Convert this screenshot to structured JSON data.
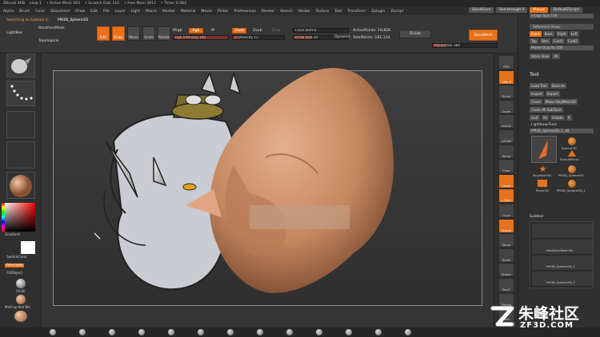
{
  "titlebar": {
    "app": "ZBrush 4R8",
    "view": "view 1",
    "active_mesh": "• Active Mesh 493",
    "scratch": "• Scratch Disk 110",
    "free_mem": "• Free Mem 3912",
    "timer": "• Timer 0.083"
  },
  "menubar": {
    "items": [
      "Alpha",
      "Brush",
      "Color",
      "Document",
      "Draw",
      "Edit",
      "File",
      "Layer",
      "Light",
      "Macro",
      "Marker",
      "Material",
      "Movie",
      "Picker",
      "Preferences",
      "Render",
      "Stencil",
      "Stroke",
      "Texture",
      "Tool",
      "Transform",
      "Zplugin",
      "Zscript"
    ],
    "quicksave": "QuickSave",
    "seethrough": "See-through 0",
    "menus": "Menus",
    "script": "DefaultZScript"
  },
  "toolbar": {
    "switching": "Switching to Subtool 4:",
    "subtool_name": "PM3D_Sphere3D",
    "lightbox": "LightBox",
    "backface": "BackfaceMask",
    "topological": "Topological",
    "edit": "Edit",
    "draw": "Draw",
    "move": "Move",
    "scale": "Scale",
    "rotate": "Rotate",
    "mrgb": "Mrgb",
    "rgb": "Rgb",
    "m": "M",
    "rgb_intensity": "Rgb Intensity 100",
    "zadd": "Zadd",
    "zsub": "Zsub",
    "zcut": "Zcut",
    "z_intensity": "Z Intensity 12",
    "focal_shift": "Focal Shift 0",
    "draw_size": "Draw Size 34",
    "dynamic": "Dynamic",
    "active_points": "ActivePoints: 16,828",
    "total_points": "TotalPoints: 181,134",
    "divide": "Divide",
    "dynamesh": "DynaMesh",
    "resolution": "Resolution 184"
  },
  "left": {
    "gradient": "Gradient",
    "switch_color": "SwitchColor",
    "alternate": "Alternate",
    "fill_object": "FillObject",
    "chalk": "Chalk",
    "matcap": "MatCap Red Wa"
  },
  "rightshelf": [
    "BPR",
    "SPix 3",
    "Scroll",
    "Zoom",
    "Actual",
    "AAHalf",
    "Persp",
    "Floor",
    "Local",
    "L.Sym",
    "Gxyz",
    "Frame",
    "Move",
    "Scale",
    "Rotate",
    "PolyF",
    "Transp",
    "Solo"
  ],
  "panel": {
    "image_size": "Image Size 100",
    "reference": "Reference Views",
    "views": [
      "Front",
      "Back",
      "Right",
      "Left"
    ],
    "views2": [
      "Top",
      "Btm",
      "Cust1",
      "Cust2"
    ],
    "model_opacity": "Model Opacity 100",
    "store_view": "Store View",
    "all": "All",
    "tool": "Tool",
    "load_tool": "Load Tool",
    "save_as": "Save As",
    "import": "Import",
    "export": "Export",
    "clone": "Clone",
    "make_poly": "Make PolyMesh3D",
    "clone_all": "Clone All SubTools",
    "goz": "GoZ",
    "all2": "All",
    "visible": "Visible",
    "r": "R",
    "lightbox_tools": "Lightbox▸Tools",
    "current_tool": "PM3D_Sphere3D_1. 48",
    "tools": [
      "Sphere3D",
      "SimpleBrush",
      "PolyMesh3D",
      "PM3D_Sphere3D",
      "Plane3D",
      "PM3D_Sphere3D_2"
    ],
    "subtool": "Subtool",
    "subtools": [
      "WaxDuckMesh3D",
      "PM3D_Sphere3D_1",
      "PM3D_Sphere3D_2"
    ]
  },
  "watermark": {
    "cn": "朱峰社区",
    "en": "ZF3D.COM"
  }
}
